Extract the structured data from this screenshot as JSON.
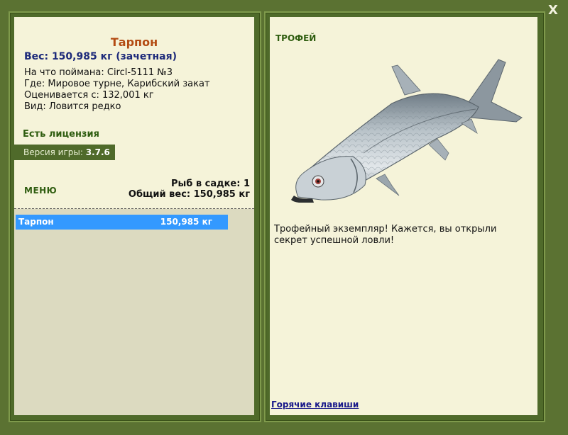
{
  "close_button": {
    "label": "X"
  },
  "fish_info": {
    "name": "Тарпон",
    "weight_line": "Вес: 150,985 кг (зачетная)",
    "caught_with": "На что поймана: Circl-5111 №3",
    "location": "Где: Мировое турне, Карибский закат",
    "valued_from": "Оценивается с: 132,001 кг",
    "rarity": "Вид: Ловится редко"
  },
  "license": "Есть лицензия",
  "version": {
    "label": "Версия игры:",
    "value": "3.7.6"
  },
  "menu_label": "МЕНЮ",
  "keepnet": {
    "fish_count": "Рыб в садке: 1",
    "total_weight": "Общий вес: 150,985 кг"
  },
  "fish_list": [
    {
      "name": "Тарпон",
      "weight": "150,985 кг"
    }
  ],
  "trophy": {
    "label": "ТРОФЕЙ",
    "image": "tarpon-fish-image",
    "description": "Трофейный экземпляр! Кажется, вы открыли секрет успешной ловли!"
  },
  "hotkeys_link": "Горячие клавиши",
  "colors": {
    "background": "#5b7232",
    "panel": "#f5f3d9",
    "title": "#b34b12",
    "weight": "#1d2a7a",
    "accent_green": "#2f5d10",
    "selection": "#3399ff"
  }
}
